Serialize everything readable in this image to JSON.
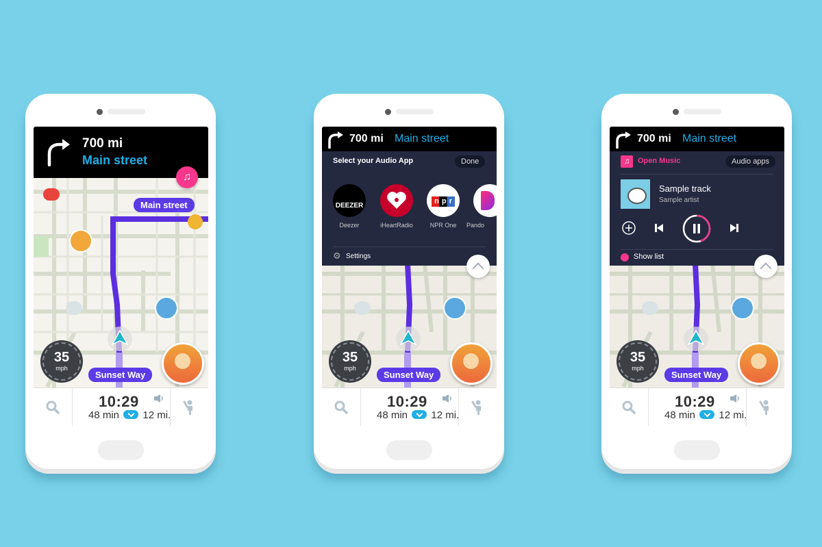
{
  "colors": {
    "background": "#78d1e8",
    "street_blue": "#1faee8",
    "route_purple": "#5b3be6",
    "music_pink": "#f6378c",
    "panel_dark": "#242940"
  },
  "phones": [
    {
      "nav": {
        "distance": "700 mi",
        "street": "Main street",
        "turn_icon": "turn-right-arrow"
      },
      "map": {
        "route_label": "Main street",
        "current_street": "Sunset Way",
        "music_button_icon": "music-note"
      },
      "speed": {
        "value": "35",
        "unit": "mph"
      },
      "bottom": {
        "eta": "10:29",
        "duration": "48 min",
        "distance": "12 mi."
      }
    },
    {
      "nav": {
        "distance": "700 mi",
        "street": "Main street"
      },
      "audio_picker": {
        "title": "Select your Audio App",
        "done_label": "Done",
        "apps": [
          {
            "name": "Deezer",
            "logo_text": "DEEZER"
          },
          {
            "name": "iHeartRadio"
          },
          {
            "name": "NPR One",
            "logo_text": "npr"
          },
          {
            "name": "Pando"
          }
        ],
        "settings_label": "Settings"
      },
      "map": {
        "current_street": "Sunset Way"
      },
      "speed": {
        "value": "35",
        "unit": "mph"
      },
      "bottom": {
        "eta": "10:29",
        "duration": "48 min",
        "distance": "12 mi."
      }
    },
    {
      "nav": {
        "distance": "700 mi",
        "street": "Main street"
      },
      "player": {
        "app_label": "Open Music",
        "audio_apps_label": "Audio apps",
        "track": "Sample track",
        "artist": "Sample artist",
        "progress": 0.45,
        "show_list_label": "Show list"
      },
      "map": {
        "current_street": "Sunset Way"
      },
      "speed": {
        "value": "35",
        "unit": "mph"
      },
      "bottom": {
        "eta": "10:29",
        "duration": "48 min",
        "distance": "12 mi."
      }
    }
  ]
}
